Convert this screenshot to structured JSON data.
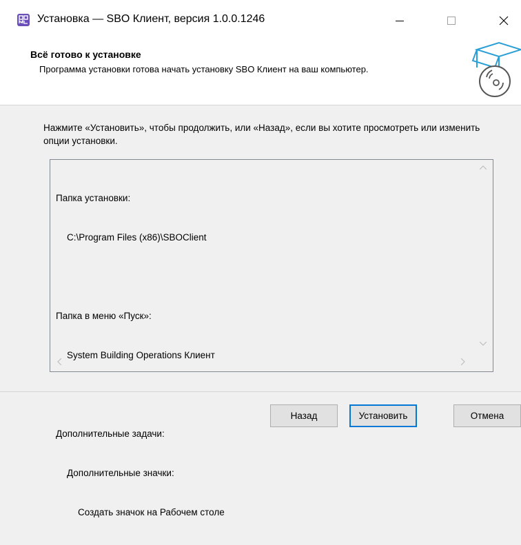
{
  "window": {
    "title": "Установка — SBO Клиент, версия 1.0.0.1246",
    "icon": "app-logo-icon"
  },
  "header": {
    "title": "Всё готово к установке",
    "description": "Программа установки готова начать установку SBO Клиент на ваш компьютер."
  },
  "intro": "Нажмите «Установить», чтобы продолжить, или «Назад», если вы хотите просмотреть или изменить опции установки.",
  "memo": {
    "lines": [
      "Папка установки:",
      "C:\\Program Files (x86)\\SBOClient",
      "",
      "Папка в меню «Пуск»:",
      "System Building Operations Клиент",
      "",
      "Дополнительные задачи:",
      "Дополнительные значки:",
      "Создать значок на Рабочем столе"
    ]
  },
  "buttons": {
    "back": "Назад",
    "install": "Установить",
    "cancel": "Отмена"
  },
  "colors": {
    "accent": "#0078d7",
    "app_icon": "#6a4fb8"
  }
}
